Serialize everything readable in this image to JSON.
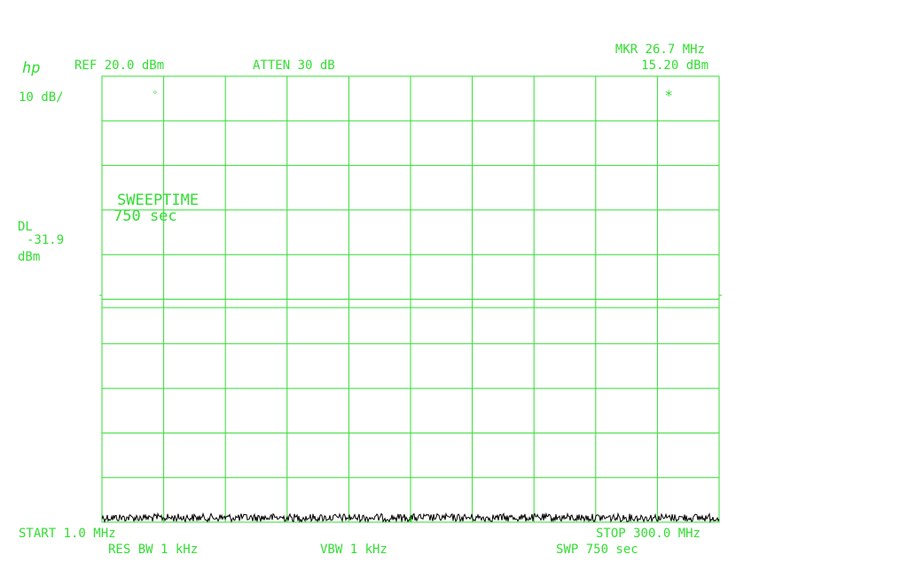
{
  "header": {
    "logo": "hp",
    "ref": "REF 20.0 dBm",
    "atten": "ATTEN 30 dB",
    "marker_freq": "MKR 26.7 MHz",
    "marker_level": "15.20 dBm"
  },
  "left_panel": {
    "scale": "10 dB/",
    "dl_label": "DL",
    "dl_value": "-31.9",
    "dl_unit": "dBm"
  },
  "annotation": {
    "line1": "SWEEPTIME",
    "line2": "750  sec"
  },
  "footer": {
    "start": "START 1.0 MHz",
    "stop": "STOP 300.0 MHz",
    "res_bw": "RES BW 1 kHz",
    "vbw": "VBW 1 kHz",
    "swp": "SWP 750  sec"
  },
  "colors": {
    "grid": "#33dd33",
    "trace": "#000000",
    "text": "#33dd33"
  },
  "chart_data": {
    "type": "line",
    "x_range_mhz": [
      1.0,
      300.0
    ],
    "y_range_dbm": [
      -80,
      20
    ],
    "grid": true,
    "display_line_dbm": -31.9,
    "noise_floor_dbm": -79,
    "marker": {
      "x": 26.7,
      "y": 15.2,
      "symbol": "*"
    },
    "peaks": []
  }
}
